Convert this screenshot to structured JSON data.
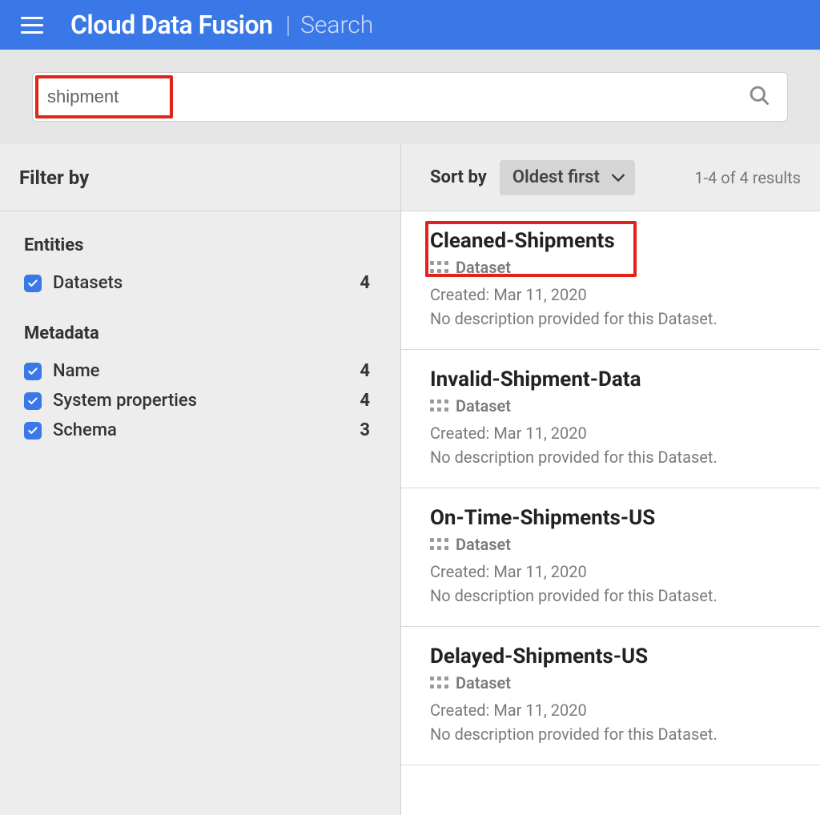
{
  "header": {
    "brand": "Cloud Data Fusion",
    "page": "Search"
  },
  "search": {
    "value": "shipment"
  },
  "sidebar": {
    "title": "Filter by",
    "groups": [
      {
        "title": "Entities",
        "items": [
          {
            "label": "Datasets",
            "count": "4"
          }
        ]
      },
      {
        "title": "Metadata",
        "items": [
          {
            "label": "Name",
            "count": "4"
          },
          {
            "label": "System properties",
            "count": "4"
          },
          {
            "label": "Schema",
            "count": "3"
          }
        ]
      }
    ]
  },
  "results": {
    "sort_label": "Sort by",
    "sort_value": "Oldest first",
    "count_text": "1-4 of 4 results",
    "items": [
      {
        "title": "Cleaned-Shipments",
        "type": "Dataset",
        "created": "Created: Mar 11, 2020",
        "desc": "No description provided for this Dataset."
      },
      {
        "title": "Invalid-Shipment-Data",
        "type": "Dataset",
        "created": "Created: Mar 11, 2020",
        "desc": "No description provided for this Dataset."
      },
      {
        "title": "On-Time-Shipments-US",
        "type": "Dataset",
        "created": "Created: Mar 11, 2020",
        "desc": "No description provided for this Dataset."
      },
      {
        "title": "Delayed-Shipments-US",
        "type": "Dataset",
        "created": "Created: Mar 11, 2020",
        "desc": "No description provided for this Dataset."
      }
    ]
  }
}
